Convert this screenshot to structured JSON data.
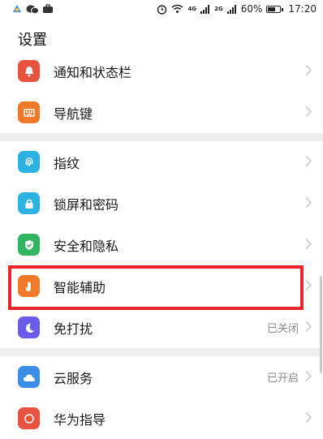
{
  "status_bar": {
    "battery_text": "60%",
    "time": "17:20",
    "signal1": "4G",
    "signal2": "2G",
    "battery_level": 0.6
  },
  "header": {
    "title": "设置"
  },
  "rows": [
    {
      "label": "通知和状态栏",
      "value": "",
      "icon": "bell-icon",
      "color": "#e8533f"
    },
    {
      "label": "导航键",
      "value": "",
      "icon": "keyboard-icon",
      "color": "#f07a2a"
    },
    {
      "label": "指纹",
      "value": "",
      "icon": "fingerprint-icon",
      "color": "#2bb2e2"
    },
    {
      "label": "锁屏和密码",
      "value": "",
      "icon": "lock-icon",
      "color": "#2bb2e2"
    },
    {
      "label": "安全和隐私",
      "value": "",
      "icon": "shield-check-icon",
      "color": "#32b561"
    },
    {
      "label": "智能辅助",
      "value": "",
      "icon": "hand-icon",
      "color": "#f07a2a"
    },
    {
      "label": "免打扰",
      "value": "已关闭",
      "icon": "moon-icon",
      "color": "#6a5ce8"
    },
    {
      "label": "云服务",
      "value": "已开启",
      "icon": "cloud-icon",
      "color": "#3b8ee8"
    },
    {
      "label": "华为指导",
      "value": "",
      "icon": "guide-icon",
      "color": "#e8533f"
    }
  ],
  "colors": {
    "highlight": "#e8262b",
    "section_gap": "#eeeeee"
  }
}
